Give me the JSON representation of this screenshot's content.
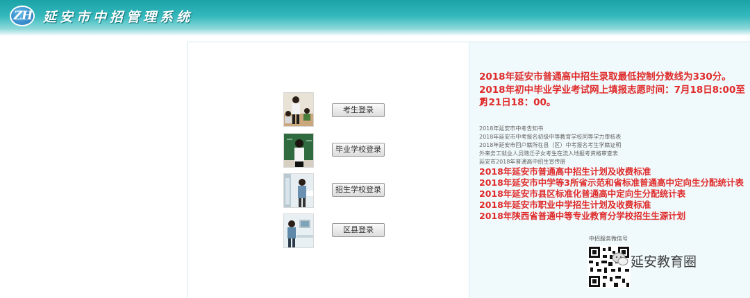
{
  "header": {
    "logo_text": "ZH",
    "title": "延安市中招管理系统"
  },
  "login": {
    "items": [
      {
        "label": "考生登录",
        "photo": "student-photo"
      },
      {
        "label": "毕业学校登录",
        "photo": "teacher-blackboard-photo"
      },
      {
        "label": "招生学校登录",
        "photo": "office-staff-photo"
      },
      {
        "label": "区县登录",
        "photo": "computer-desk-photo"
      }
    ]
  },
  "notices": {
    "headline1": "2018年延安市普通高中招生录取最低控制分数线为330分。",
    "headline2_line1": "2018年初中毕业学业考试网上填报志愿时间：7月18日8:00至7",
    "headline2_line2": "月21日18：00。",
    "small_links": [
      "2018年延安市中考告知书",
      "2018年延安市中考报名初级中等教育学校同等学力审核表",
      "2018年延安市回户籍所在县（区）中考报名考生学籍证明",
      "外来务工就业人员随迁子女考生在流入地报考资格审查表",
      "延安市2018年普通高中招生宣传册"
    ],
    "red_links": [
      "2018年延安市普通高中招生计划及收费标准",
      "2018年延安市中学等3所省示范和省标准普通高中定向生分配统计表",
      "2018年延安市县区标准化普通高中定向生分配统计表",
      "2018年延安市职业中学招生计划及收费标准",
      "2018年陕西省普通中等专业教育分学校招生生源计划"
    ]
  },
  "wechat": {
    "caption": "中招服务微信号",
    "brand": "延安教育圈"
  },
  "colors": {
    "accent_red": "#e02a2a",
    "header_teal": "#1aa3a8"
  }
}
